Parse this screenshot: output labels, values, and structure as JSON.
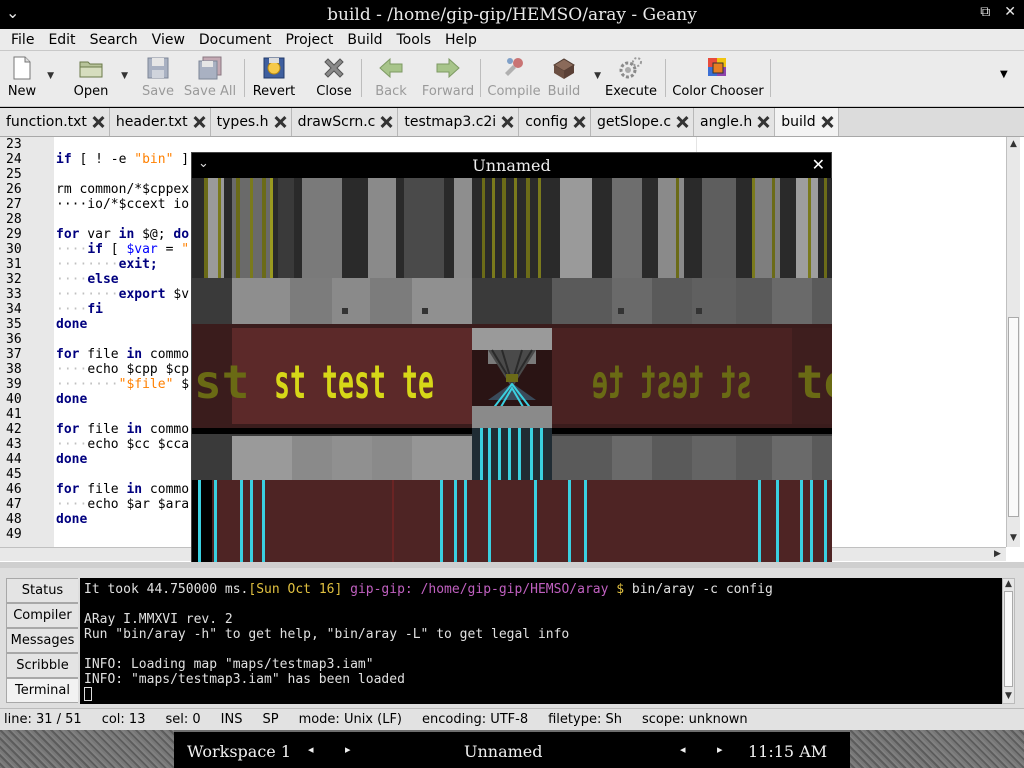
{
  "window": {
    "title": "build - /home/gip-gip/HEMSO/aray - Geany",
    "left_icon": "⌄",
    "controls": [
      "⧉",
      "✕"
    ]
  },
  "menubar": [
    {
      "label": "File"
    },
    {
      "label": "Edit"
    },
    {
      "label": "Search"
    },
    {
      "label": "View"
    },
    {
      "label": "Document"
    },
    {
      "label": "Project"
    },
    {
      "label": "Build"
    },
    {
      "label": "Tools"
    },
    {
      "label": "Help"
    }
  ],
  "toolbar": {
    "new": "New",
    "open": "Open",
    "save": "Save",
    "save_all": "Save All",
    "revert": "Revert",
    "close": "Close",
    "back": "Back",
    "forward": "Forward",
    "compile": "Compile",
    "build": "Build",
    "execute": "Execute",
    "color_chooser": "Color Chooser"
  },
  "tabs": [
    {
      "label": "function.txt"
    },
    {
      "label": "header.txt"
    },
    {
      "label": "types.h"
    },
    {
      "label": "drawScrn.c"
    },
    {
      "label": "testmap3.c2i"
    },
    {
      "label": "config"
    },
    {
      "label": "getSlope.c"
    },
    {
      "label": "angle.h"
    },
    {
      "label": "build"
    }
  ],
  "editor": {
    "line_numbers": [
      "23",
      "24",
      "25",
      "26",
      "27",
      "28",
      "29",
      "30",
      "31",
      "32",
      "33",
      "34",
      "35",
      "36",
      "37",
      "38",
      "39",
      "40",
      "41",
      "42",
      "43",
      "44",
      "45",
      "46",
      "47",
      "48",
      "49"
    ],
    "lines": {
      "l24a": "if",
      "l24b": " [ ! -e ",
      "l24c": "\"bin\"",
      "l24d": " ]",
      "l26": "rm common/*$cppex",
      "l27": "····io/*$ccext io",
      "l29a": "for",
      "l29b": " var ",
      "l29c": "in",
      "l29d": " $@; ",
      "l29e": "do",
      "l30a": "····",
      "l30b": "if",
      "l30c": " [ ",
      "l30d": "$var",
      "l30e": " = ",
      "l30f": "\"",
      "l31a": "········",
      "l31b": "exit;",
      "l32a": "····",
      "l32b": "else",
      "l33a": "········",
      "l33b": "export",
      "l33c": " $v",
      "l34a": "····",
      "l34b": "fi",
      "l35": "done",
      "l37a": "for",
      "l37b": " file ",
      "l37c": "in",
      "l37d": " commo",
      "l38a": "····",
      "l38b": "echo $cpp $cp",
      "l39a": "········",
      "l39b": "\"$file\"",
      "l39c": " $",
      "l40": "done",
      "l42a": "for",
      "l42b": " file ",
      "l42c": "in",
      "l42d": " commo",
      "l43a": "····",
      "l43b": "echo $cc $cca",
      "l44": "done",
      "l46a": "for",
      "l46b": " file ",
      "l46c": "in",
      "l46d": " commo",
      "l47a": "····",
      "l47b": "echo $ar $ara",
      "l48": "done"
    }
  },
  "game_window": {
    "title": "Unnamed",
    "min_icon": "⌄",
    "close_icon": "✕",
    "banner_text_left_edge": "st",
    "banner_text_main": "st test te",
    "banner_text_right": "st test te",
    "banner_text_right_edge": "te"
  },
  "message_tabs": [
    {
      "label": "Status"
    },
    {
      "label": "Compiler"
    },
    {
      "label": "Messages"
    },
    {
      "label": "Scribble"
    },
    {
      "label": "Terminal"
    }
  ],
  "terminal": {
    "line1_a": "It took 44.750000 ms.",
    "line1_b": "[Sun Oct 16] ",
    "line1_c": "gip-gip: ",
    "line1_d": "/home/gip-gip/HEMSO/aray",
    "line1_e": " $ ",
    "line1_f": "bin/aray -c config",
    "line2": "",
    "line3": "ARay I.MMXVI rev. 2",
    "line4": "Run \"bin/aray -h\" to get help, \"bin/aray -L\" to get legal info",
    "line5": "",
    "line6": "INFO: Loading map \"maps/testmap3.iam\"",
    "line7": "INFO: \"maps/testmap3.iam\" has been loaded"
  },
  "statusbar": {
    "line": "line: 31 / 51",
    "col": "col: 13",
    "sel": "sel: 0",
    "ins": "INS",
    "sp": "SP",
    "mode": "mode: Unix (LF)",
    "encoding": "encoding: UTF-8",
    "filetype": "filetype: Sh",
    "scope": "scope: unknown"
  },
  "panel": {
    "workspace": "Workspace 1",
    "task_title": "Unnamed",
    "clock": "11:15 AM",
    "nav_left": "◂ ▸",
    "nav_right": "◂ ▸"
  }
}
